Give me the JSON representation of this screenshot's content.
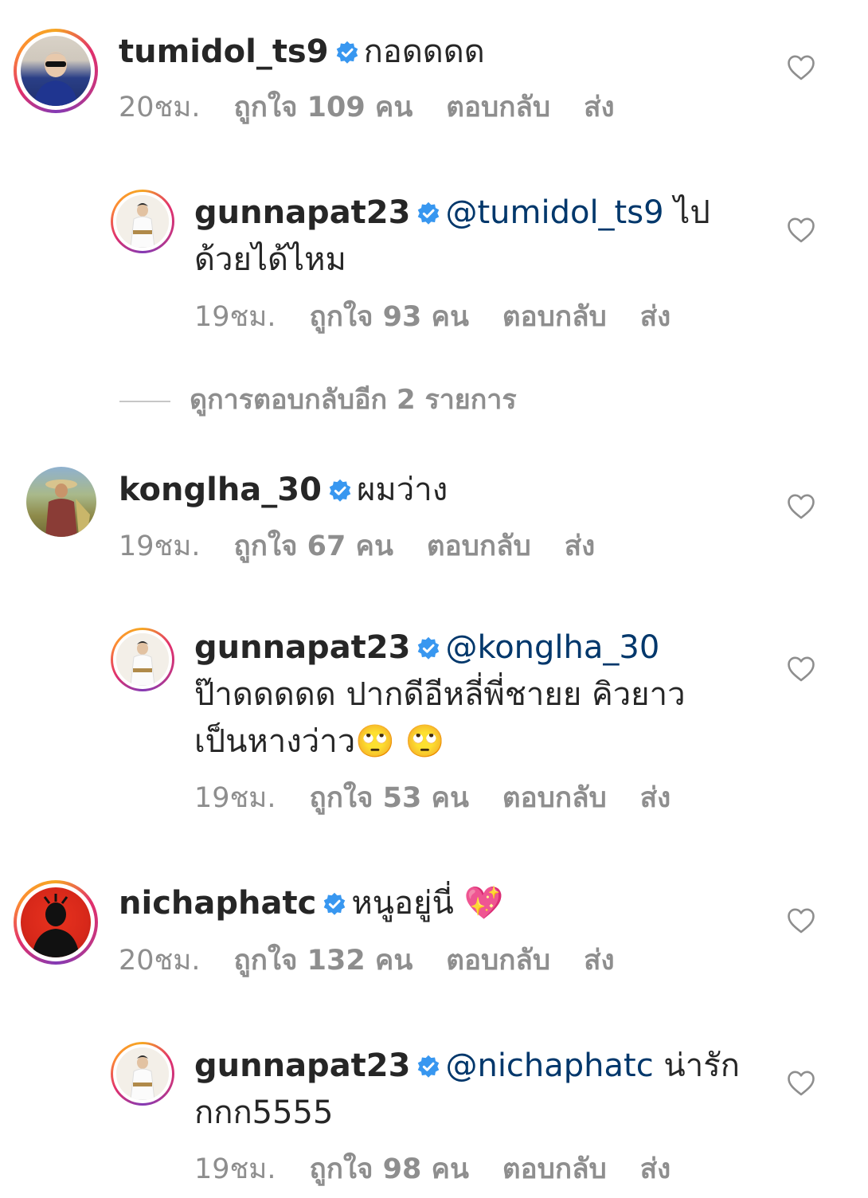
{
  "comments": [
    {
      "username": "tumidol_ts9",
      "text": "กอดดดด",
      "time": "20ชม.",
      "likes": "ถูกใจ 109 คน",
      "reply_label": "ตอบกลับ",
      "send_label": "ส่ง"
    },
    {
      "username": "gunnapat23",
      "mention": "@tumidol_ts9",
      "text_line1": " ไป",
      "text_line2": "ด้วยได้ไหม",
      "time": "19ชม.",
      "likes": "ถูกใจ 93 คน",
      "reply_label": "ตอบกลับ",
      "send_label": "ส่ง"
    },
    {
      "view_more": "ดูการตอบกลับอีก 2 รายการ"
    },
    {
      "username": "konglha_30",
      "text": "ผมว่าง",
      "time": "19ชม.",
      "likes": "ถูกใจ 67 คน",
      "reply_label": "ตอบกลับ",
      "send_label": "ส่ง"
    },
    {
      "username": "gunnapat23",
      "mention": "@konglha_30",
      "text_line2": "ป๊าดดดดด ปากดีอีหลี่พี่ชายย คิวยาว",
      "text_line3": "เป็นหางว่าว🙄 🙄",
      "time": "19ชม.",
      "likes": "ถูกใจ 53 คน",
      "reply_label": "ตอบกลับ",
      "send_label": "ส่ง"
    },
    {
      "username": "nichaphatc",
      "text": "หนูอยู่นี่ 💖",
      "time": "20ชม.",
      "likes": "ถูกใจ 132 คน",
      "reply_label": "ตอบกลับ",
      "send_label": "ส่ง"
    },
    {
      "username": "gunnapat23",
      "mention": "@nichaphatc",
      "text_line1": " น่ารัก",
      "text_line2": "กกก5555",
      "time": "19ชม.",
      "likes": "ถูกใจ 98 คน",
      "reply_label": "ตอบกลับ",
      "send_label": "ส่ง"
    }
  ],
  "colors": {
    "verified_badge": "#3897f0",
    "mention": "#00376b",
    "meta_gray": "#8e8e8e"
  },
  "icons": {
    "verified": "verified-badge-icon",
    "heart": "heart-outline-icon"
  }
}
